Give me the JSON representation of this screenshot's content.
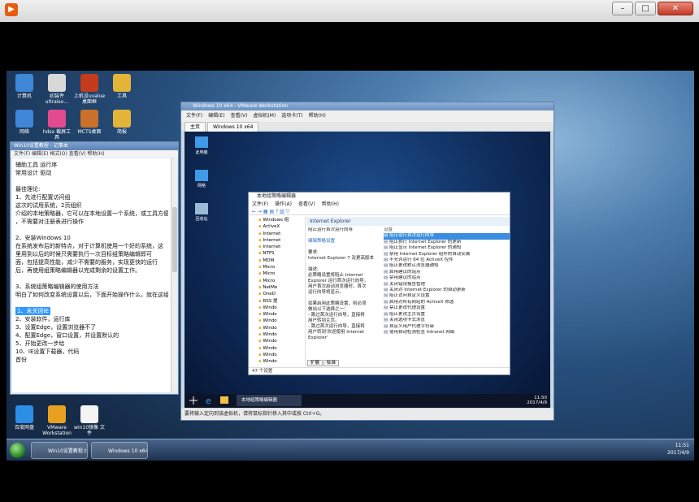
{
  "desktop_icons_top": [
    {
      "label": "计算机",
      "color": "#3f86d6"
    },
    {
      "label": "初装件 ultraiso…",
      "color": "#d8d8d8"
    },
    {
      "label": "上机设uvalue 桌面框",
      "color": "#c33c1c"
    },
    {
      "label": "工具",
      "color": "#e2b53a"
    }
  ],
  "desktop_icons_mid": [
    {
      "label": "网络",
      "color": "#3f86d6"
    },
    {
      "label": "hdsx 截屏工具",
      "color": "#e24c8f"
    },
    {
      "label": "MCTS桌面",
      "color": "#c9702a"
    },
    {
      "label": "简报",
      "color": "#e2b53a"
    }
  ],
  "desktop_icons_bottom": [
    {
      "label": "百度网盘",
      "color": "#2d8ee8"
    },
    {
      "label": "VMware Workstation",
      "color": "#e7a020"
    },
    {
      "label": "win10镜像 文件",
      "color": "#f4f4f4"
    }
  ],
  "notepad": {
    "title": "Win10设置教程 - 记事本",
    "menu": "文件(F)  编辑(E)  格式(O)  查看(V)  帮助(H)",
    "lines": [
      {
        "text": "   辅助工具          运行序",
        "sel": false
      },
      {
        "text": "   常用设计          驱动",
        "sel": false
      },
      {
        "text": "",
        "sel": false
      },
      {
        "text": "最佳理论:",
        "sel": false
      },
      {
        "text": "   1、先进行配置访问组",
        "sel": false
      },
      {
        "text": "      这次的试用系统，2页组织",
        "sel": false
      },
      {
        "text": "介绍的本地策略器，它可以在本地设置一个系统，或工具方便一些",
        "sel": false
      },
      {
        "text": "，不需要对注册表进行操作",
        "sel": false
      },
      {
        "text": "",
        "sel": false
      },
      {
        "text": "   2、安装Windows 10",
        "sel": false
      },
      {
        "text": "在系统发布后的新特点，对于计算机使用一个好的系统，这",
        "sel": false
      },
      {
        "text": "里用到以后的时候只需要执行一次目标组策略编辑即可",
        "sel": false
      },
      {
        "text": "面，包括提高性能，减少不需要的服务，实现更快的运行",
        "sel": false
      },
      {
        "text": "后，再使用组策略编辑器以完成剩余的设置工作。",
        "sel": false
      },
      {
        "text": "",
        "sel": false
      },
      {
        "text": "   3、系统组策略编辑器的使用方法",
        "sel": false
      },
      {
        "text": "明白了如何改变系统设置以后，下面开始操作什么，就在这组",
        "sel": false
      },
      {
        "text": "",
        "sel": false
      },
      {
        "text": "   1、未关闭IE",
        "sel": true
      },
      {
        "text": "   2、安装软件，运行库",
        "sel": false
      },
      {
        "text": "   3、设置Edge，设置浏览器不了",
        "sel": false
      },
      {
        "text": "   4、配置Edge，窗口设置，并设置默认的",
        "sel": false
      },
      {
        "text": "   5、开始更改一步给",
        "sel": false
      },
      {
        "text": "   10、IE设置下载器，代码",
        "sel": false
      },
      {
        "text": "      首份",
        "sel": false
      }
    ]
  },
  "vmware": {
    "title": "Windows 10 x64 - VMware Workstation",
    "menu": [
      "文件(F)",
      "编辑(E)",
      "查看(V)",
      "虚拟机(M)",
      "选项卡(T)",
      "帮助(H)"
    ],
    "tabs": [
      "主页",
      "Windows 10 x64"
    ],
    "status": "要将输入定向到该虚拟机，请将鼠标指针移入其中或按 Ctrl+G。",
    "guest_icons": [
      {
        "label": "此电脑",
        "color": "#3f9ae8"
      },
      {
        "label": "网络",
        "color": "#3f9ae8"
      },
      {
        "label": "回收站",
        "color": "#9bbbd4"
      }
    ],
    "guest_taskbar_item": "本地组策略编辑器",
    "guest_clock": "11:50 2017/4/9"
  },
  "gpedit": {
    "title": "本地组策略编辑器",
    "menu": [
      "文件(F)",
      "操作(A)",
      "查看(V)",
      "帮助(H)"
    ],
    "tool": "← →  ▦  ▤  ?  ▥  ▽",
    "tree": [
      "Windows 组",
      "ActiveX",
      "Internet",
      "Internet",
      "Internet",
      "NTFS",
      "MDM",
      "Micro",
      "Micro",
      "Micro",
      "NetMe",
      "OneD",
      "RSS 提",
      "Windo",
      "Windo",
      "Windo",
      "Windo",
      "Windo",
      "Windo",
      "Windo",
      "Windo",
      "Windo"
    ],
    "header": "Internet Explorer",
    "desc": [
      "阻止运行首次运行向导",
      "",
      "编辑策略设置",
      "",
      "要求:",
      "Internet Explorer 7 及更高版本",
      "",
      "描述:",
      "此策略设置将阻止 Internet",
      "Explorer 运行首次运行向导，",
      "用户首次启动浏览器时，首次",
      "运行向导将显示。",
      "",
      "如果启用此策略设置，则必须",
      "做出以下选择之一：",
      "- 跳过首次运行向导，直接将",
      "用户转到主页。",
      "- 跳过首次运行向导，直接将",
      "用户转到'欢迎使用 Internet Explorer'"
    ],
    "list_header": "设置",
    "list": [
      {
        "text": "阻止运行首次运行向导",
        "sel": true
      },
      {
        "text": "阻止执行 Internet Explorer 的更新",
        "sel": false
      },
      {
        "text": "阻止显示 Internet Explorer 的通知",
        "sel": false
      },
      {
        "text": "禁用 Internet Explorer 组件的自动安装",
        "sel": false
      },
      {
        "text": "不允许运行 64 位 ActiveX 控件",
        "sel": false
      },
      {
        "text": "阻止更改默认浏览器通知",
        "sel": false
      },
      {
        "text": "启用建议的站点",
        "sel": false
      },
      {
        "text": "禁用建议的站点",
        "sel": false
      },
      {
        "text": "关闭错误报告管理",
        "sel": false
      },
      {
        "text": "关闭对 Internet Explorer 的自动更新",
        "sel": false
      },
      {
        "text": "阻止访问自定义设置",
        "sel": false
      },
      {
        "text": "启用对所有网站的 ActiveX 筛选",
        "sel": false
      },
      {
        "text": "禁止更改代理设置",
        "sel": false
      },
      {
        "text": "阻止更改主页设置",
        "sel": false
      },
      {
        "text": "关闭选项卡式浏览",
        "sel": false
      },
      {
        "text": "自定义用户代理字符串",
        "sel": false
      },
      {
        "text": "使用自动检测检查 Intranet 网络",
        "sel": false
      }
    ],
    "tabs": [
      "扩展",
      "标准"
    ],
    "status": "47 个设置"
  },
  "taskbar": {
    "items": [
      "Win10设置教程.txt - ...",
      "Windows 10 x64 - ..."
    ],
    "clock_time": "11:51",
    "clock_date": "2017/4/9"
  }
}
